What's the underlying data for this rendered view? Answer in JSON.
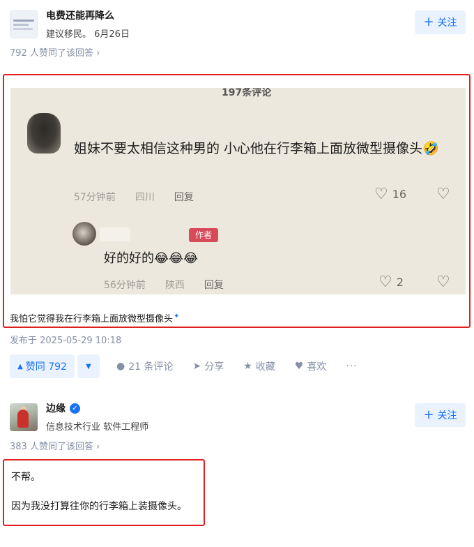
{
  "answer1": {
    "author_name": "电费还能再降么",
    "author_sub": "建议移民。 6月26日",
    "follow_label": "关注",
    "agree_text": "792 人赞同了该回答 ›",
    "screenshot": {
      "top_text": "197条评论",
      "comment": "姐妹不要太相信这种男的 小心他在行李箱上面放微型摄像头🤣",
      "comment_time": "57分钟前",
      "comment_location": "四川",
      "comment_reply": "回复",
      "comment_likes": "16",
      "author_tag": "作者",
      "reply_text": "好的好的😂😂😂",
      "reply_time": "56分钟前",
      "reply_location": "陕西",
      "reply_reply": "回复",
      "reply_likes": "2"
    },
    "caption_prefix": "我怕它觉得我在行李箱上面放",
    "caption_keyword": "微型摄像头",
    "published": "发布于 2025-05-29 10:18",
    "vote_up_label": "赞同 792",
    "comments_label": "21 条评论",
    "share_label": "分享",
    "collect_label": "收藏",
    "like_label": "喜欢",
    "more_label": "···"
  },
  "answer2": {
    "author_name": "边缘",
    "author_sub": "信息技术行业 软件工程师",
    "follow_label": "关注",
    "agree_text": "383 人赞同了该回答 ›",
    "line1": "不帮。",
    "line2": "因为我没打算往你的行李箱上装摄像头。"
  },
  "colors": {
    "accent": "#1772f6",
    "accent_bg": "#eaf2ff",
    "highlight_box": "#e02020",
    "meta_gray": "#8590a6"
  }
}
